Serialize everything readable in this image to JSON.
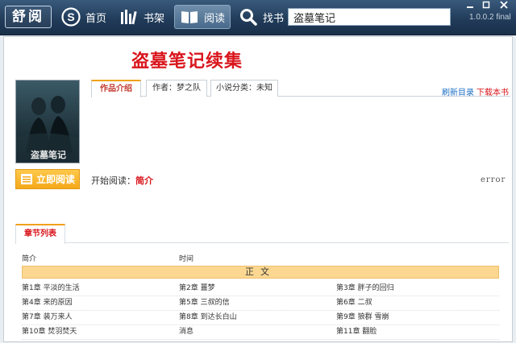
{
  "app": {
    "logo": "舒阅",
    "version": "1.0.0.2 final"
  },
  "nav": {
    "home": "首页",
    "shelf": "书架",
    "read": "阅读",
    "find": "找书"
  },
  "search": {
    "value": "盗墓笔记"
  },
  "book": {
    "title": "盗墓笔记续集",
    "cover_text": "盗墓笔记"
  },
  "info_tabs": {
    "intro": "作品介绍",
    "author": "作者：梦之队",
    "category": "小说分类：未知",
    "refresh": "刷新目录",
    "download": "下载本书"
  },
  "reading": {
    "button": "立即阅读",
    "start_label": "开始阅读：",
    "start_link": "简介",
    "error": "error"
  },
  "chapters": {
    "tab": "章节列表",
    "header_left": "简介",
    "header_mid": "时间",
    "volume": "正文",
    "rows": [
      [
        "第1章 平淡的生活",
        "第2章 噩梦",
        "第3章 胖子的回归"
      ],
      [
        "第4章 来的原因",
        "第5章 三叔的信",
        "第6章 二叔"
      ],
      [
        "第7章 装万来人",
        "第8章 到达长白山",
        "第9章 狼群 雪崩"
      ],
      [
        "第10章 焚羽焚天",
        "消息",
        "第11章 翻脸"
      ]
    ]
  },
  "colors": {
    "titlebar": "#203a58",
    "accent": "#f5a81a",
    "title_red": "#d9161c",
    "link_blue": "#1b6fc6"
  }
}
